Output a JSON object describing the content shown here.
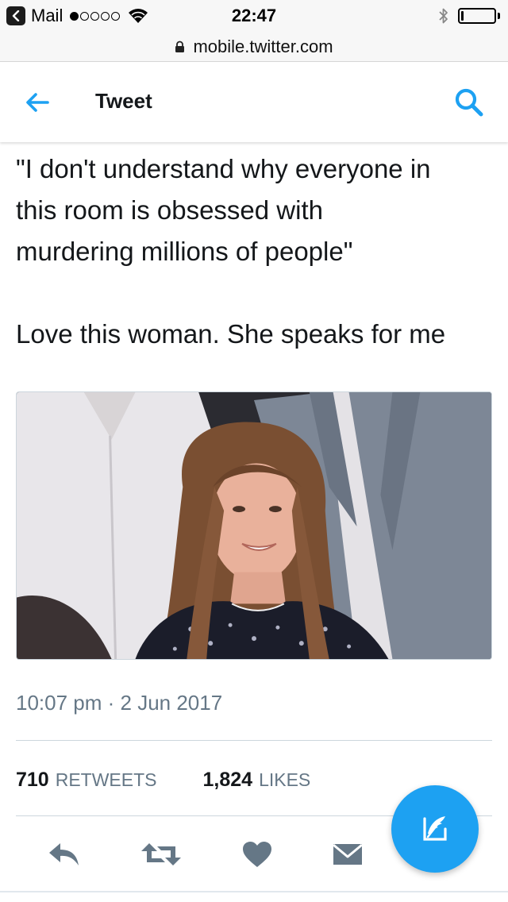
{
  "status_bar": {
    "back_app": "Mail",
    "time": "22:47",
    "signal_filled": 1,
    "signal_total": 5
  },
  "browser": {
    "url": "mobile.twitter.com"
  },
  "header": {
    "title": "Tweet",
    "back_icon": "arrow-left-icon",
    "search_icon": "search-icon"
  },
  "tweet": {
    "lines": [
      "\"I don't understand why everyone in",
      "this room is obsessed with",
      "murdering millions of people\"",
      "Love this woman. She speaks for me"
    ],
    "timestamp": "10:07 pm · 2 Jun 2017",
    "retweets": {
      "count": "710",
      "label": "RETWEETS"
    },
    "likes": {
      "count": "1,824",
      "label": "LIKES"
    }
  },
  "actions": [
    "reply-icon",
    "retweet-icon",
    "like-icon",
    "direct-message-icon"
  ],
  "compose_icon": "compose-tweet-icon",
  "colors": {
    "accent": "#1da1f2",
    "text": "#14171a",
    "secondary": "#657786",
    "divider": "#ccd6dd"
  }
}
